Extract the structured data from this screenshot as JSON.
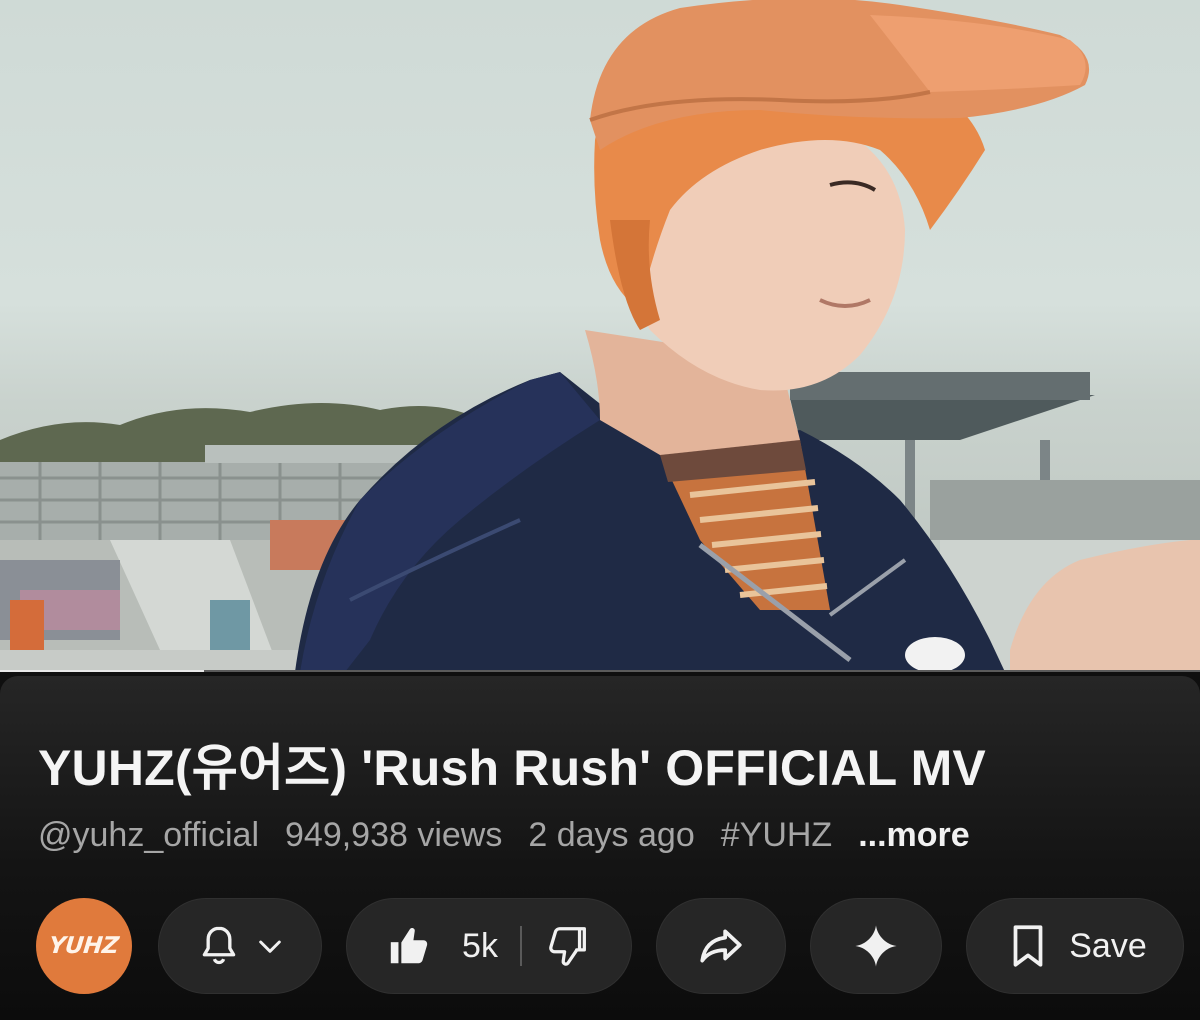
{
  "video": {
    "progress_fraction": 0.17
  },
  "title": "YUHZ(유어즈) 'Rush Rush' OFFICIAL MV",
  "meta": {
    "channel_handle": "@yuhz_official",
    "views": "949,938 views",
    "uploaded": "2 days ago",
    "hashtag": "#YUHZ",
    "more_label": "...more"
  },
  "channel": {
    "avatar_text": "YUHZ",
    "avatar_color": "#e07a3c"
  },
  "actions": {
    "subscribe_icon": "bell-icon",
    "subscribe_menu_icon": "chevron-down-icon",
    "like_icon": "thumbs-up-icon",
    "like_count": "5k",
    "dislike_icon": "thumbs-down-icon",
    "share_icon": "share-icon",
    "ask_icon": "sparkle-icon",
    "save_icon": "bookmark-icon",
    "save_label": "Save"
  }
}
